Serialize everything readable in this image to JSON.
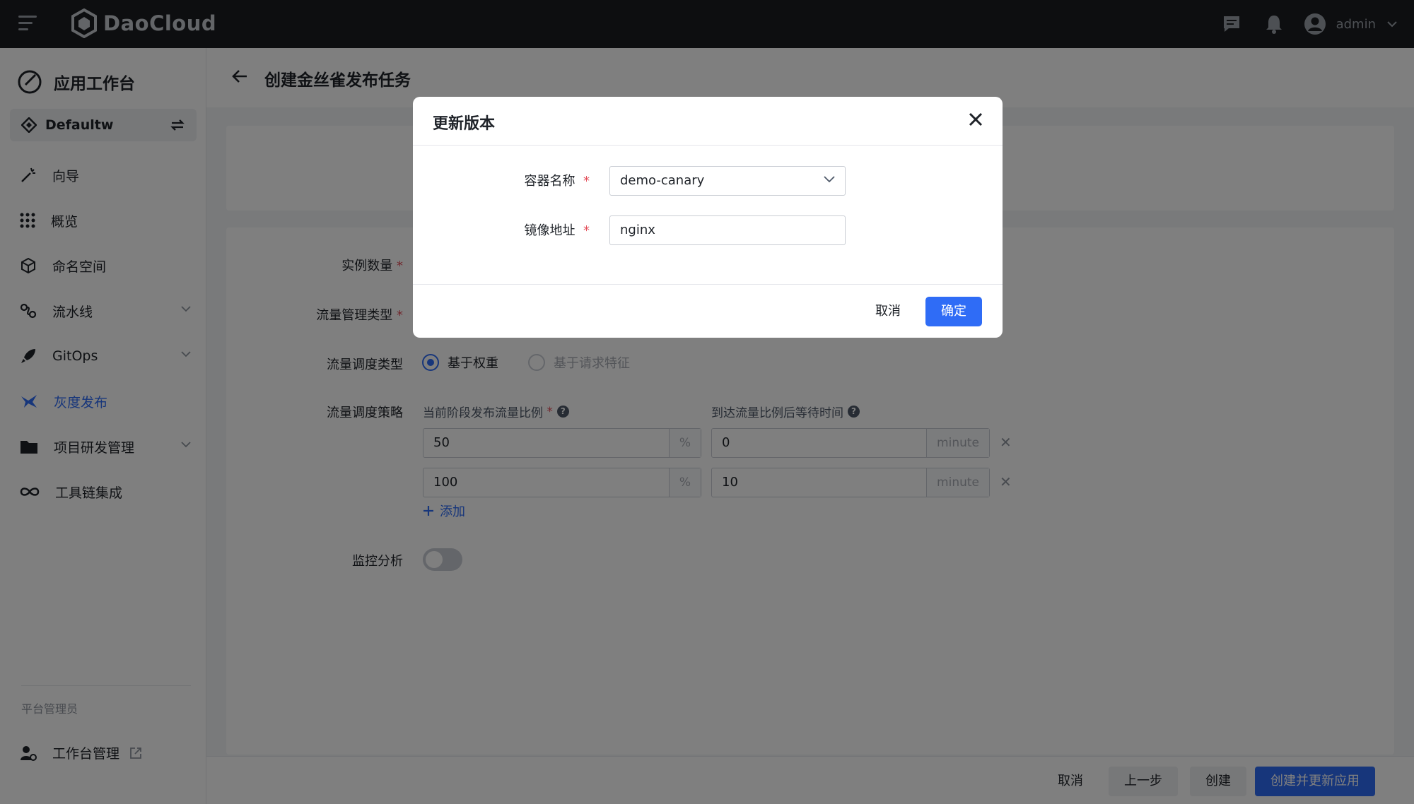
{
  "topbar": {
    "brand": "DaoCloud",
    "user": "admin"
  },
  "sidebar": {
    "title": "应用工作台",
    "workspace": "Defaultw",
    "items": [
      {
        "label": "向导",
        "icon": "wand-icon"
      },
      {
        "label": "概览",
        "icon": "grid-icon"
      },
      {
        "label": "命名空间",
        "icon": "cube-icon"
      },
      {
        "label": "流水线",
        "icon": "pipeline-icon"
      },
      {
        "label": "GitOps",
        "icon": "rocket-icon"
      },
      {
        "label": "灰度发布",
        "icon": "canary-icon",
        "active": true
      },
      {
        "label": "项目研发管理",
        "icon": "folder-icon"
      },
      {
        "label": "工具链集成",
        "icon": "infinity-icon"
      }
    ],
    "section_label": "平台管理员",
    "admin_item": "工作台管理"
  },
  "page": {
    "title": "创建金丝雀发布任务"
  },
  "form": {
    "replicas_label": "实例数量",
    "traffic_mgmt_label": "流量管理类型",
    "traffic_sched_label": "流量调度类型",
    "radio_weight": "基于权重",
    "radio_request": "基于请求特征",
    "strategy_label": "流量调度策略",
    "col_ratio": "当前阶段发布流量比例",
    "col_wait": "到达流量比例后等待时间",
    "rows": [
      {
        "ratio": "50",
        "ratio_unit": "%",
        "wait": "0",
        "wait_unit": "minute"
      },
      {
        "ratio": "100",
        "ratio_unit": "%",
        "wait": "10",
        "wait_unit": "minute"
      }
    ],
    "add_label": "添加",
    "monitor_label": "监控分析",
    "monitor_on": false
  },
  "footer": {
    "cancel": "取消",
    "prev": "上一步",
    "create": "创建",
    "create_update": "创建并更新应用"
  },
  "modal": {
    "title": "更新版本",
    "container_label": "容器名称",
    "container_value": "demo-canary",
    "image_label": "镜像地址",
    "image_value": "nginx",
    "cancel": "取消",
    "ok": "确定"
  },
  "colors": {
    "primary": "#2f6cf6",
    "topbar": "#1b1d21",
    "required": "#e34d59"
  }
}
